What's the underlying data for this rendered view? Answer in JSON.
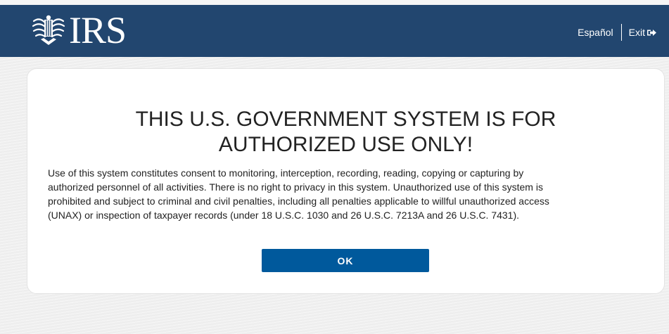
{
  "header": {
    "logo_text": "IRS",
    "language_link": "Español",
    "exit_link": "Exit",
    "background_color": "#22466f",
    "icons": {
      "logo": "irs-eagle-icon",
      "exit": "sign-out-icon"
    }
  },
  "dialog": {
    "title_lines": [
      "THIS U.S. GOVERNMENT SYSTEM IS FOR",
      "AUTHORIZED USE ONLY!"
    ],
    "body_lines": [
      "Use of this system constitutes consent to monitoring, interception, recording, reading, copying or capturing by",
      "authorized personnel of all activities. There is no right to privacy in this system. Unauthorized use of this system is",
      "prohibited and subject to criminal and civil penalties, including all penalties applicable to willful unauthorized access",
      "(UNAX) or inspection of taxpayer records (under 18 U.S.C. 1030 and 26 U.S.C. 7213A and 26 U.S.C. 7431)."
    ],
    "ok_label": "OK",
    "button_color": "#00599c"
  }
}
